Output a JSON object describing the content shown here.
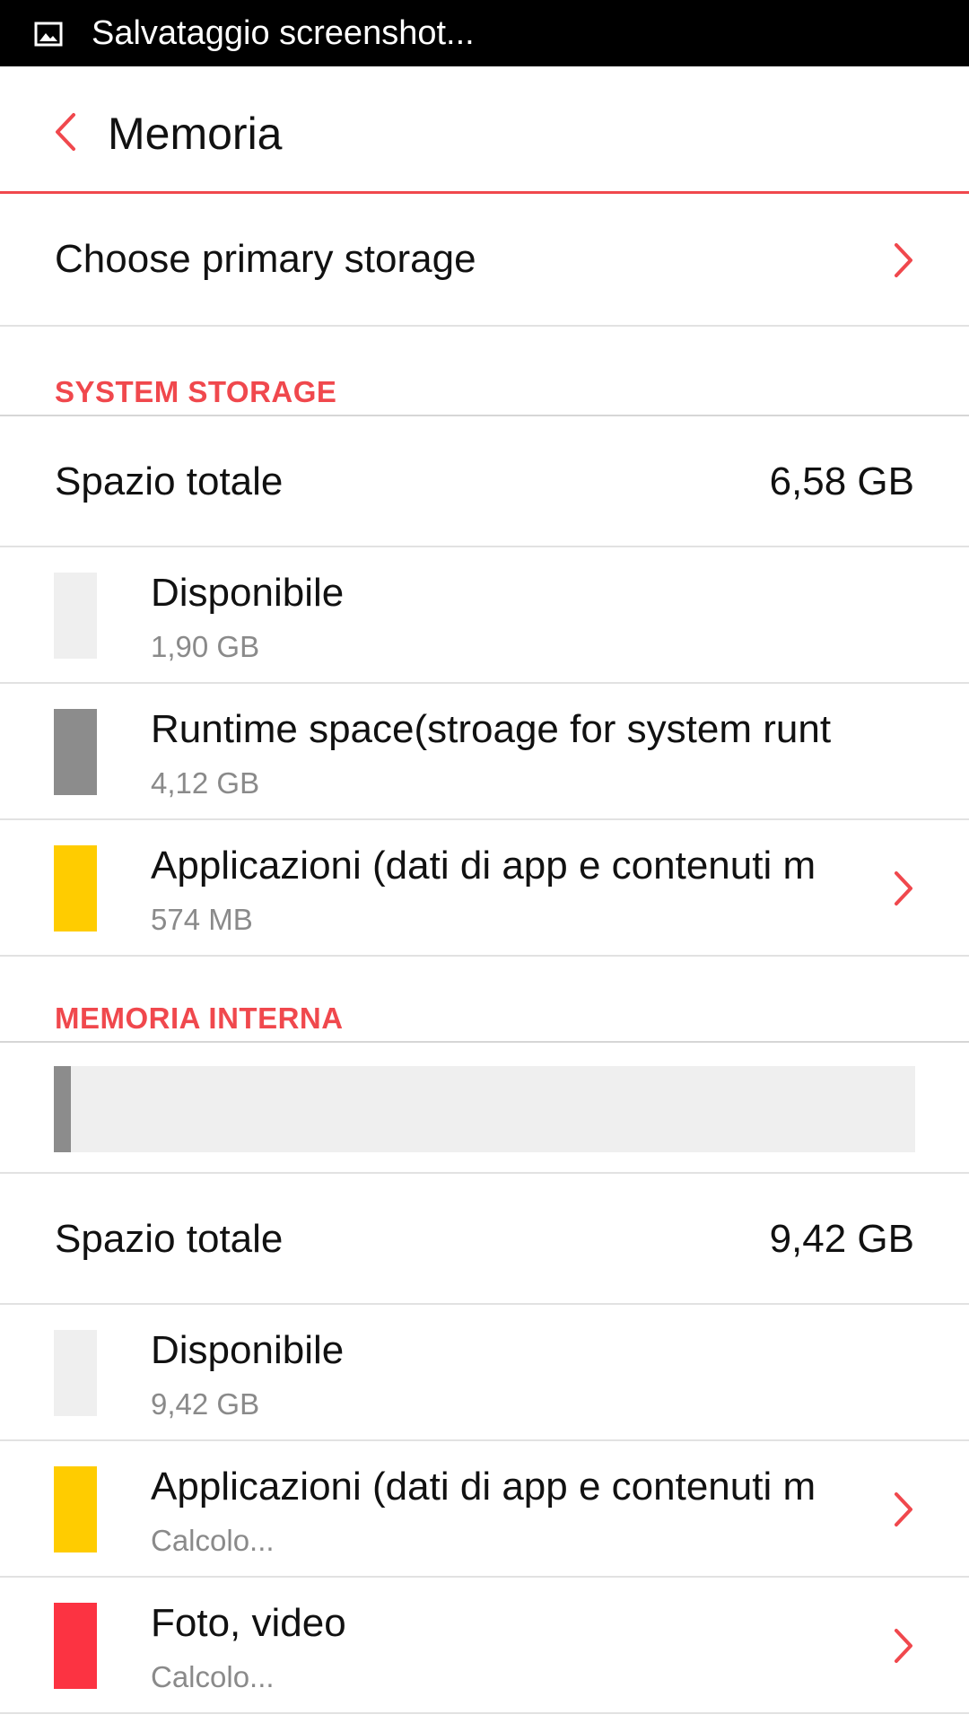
{
  "status_bar": {
    "text": "Salvataggio screenshot...",
    "icon": "image-icon"
  },
  "app_bar": {
    "title": "Memoria",
    "back_icon": "chevron-left-icon"
  },
  "primary_storage": {
    "label": "Choose primary storage"
  },
  "system_storage": {
    "header": "SYSTEM STORAGE",
    "total_label": "Spazio totale",
    "total_value": "6,58 GB",
    "items": [
      {
        "title": "Disponibile",
        "subtitle": "1,90 GB",
        "color": "#efefef",
        "has_chevron": false
      },
      {
        "title": "Runtime space(stroage for system runt",
        "subtitle": "4,12 GB",
        "color": "#8c8c8c",
        "has_chevron": false
      },
      {
        "title": "Applicazioni (dati di app e contenuti m",
        "subtitle": "574 MB",
        "color": "#ffcc00",
        "has_chevron": true
      }
    ]
  },
  "internal_memory": {
    "header": "MEMORIA INTERNA",
    "usage_fraction_used": 0.02,
    "usage_used_color": "#8c8c8c",
    "usage_free_color": "#efefef",
    "total_label": "Spazio totale",
    "total_value": "9,42 GB",
    "items": [
      {
        "title": "Disponibile",
        "subtitle": "9,42 GB",
        "color": "#efefef",
        "has_chevron": false
      },
      {
        "title": "Applicazioni (dati di app e contenuti m",
        "subtitle": "Calcolo...",
        "color": "#ffcc00",
        "has_chevron": true
      },
      {
        "title": "Foto, video",
        "subtitle": "Calcolo...",
        "color": "#fc3342",
        "has_chevron": true
      }
    ]
  },
  "colors": {
    "accent": "#f0484d",
    "divider": "#e2e2e2",
    "secondary_text": "#8a8a8a"
  }
}
